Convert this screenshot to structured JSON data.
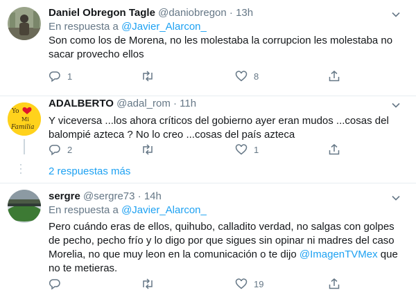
{
  "tweets": [
    {
      "name": "Daniel Obregon Tagle",
      "handle": "@daniobregon",
      "dot": "·",
      "time": "13h",
      "reply_prefix": "En respuesta a",
      "reply_to": "@Javier_Alarcon_",
      "body_lines": [
        "Son como los de Morena, no les molestaba la corrupcion les molestaba no",
        "sacar provecho ellos"
      ],
      "replies": "1",
      "retweets": "",
      "likes": "8"
    },
    {
      "name": "ADALBERTO",
      "handle": "@adal_rom",
      "dot": "·",
      "time": "11h",
      "body_lines": [
        "Y viceversa ...los ahora críticos del gobierno ayer eran mudos ...cosas del",
        "balompié azteca ? No lo creo ...cosas del país azteca"
      ],
      "replies": "2",
      "retweets": "",
      "likes": "1",
      "avatar_text": [
        "Yo",
        "Mi",
        "Familia"
      ]
    },
    {
      "name": "sergre",
      "handle": "@sergre73",
      "dot": "·",
      "time": "14h",
      "reply_prefix": "En respuesta a",
      "reply_to": "@Javier_Alarcon_",
      "body_lines": [
        "Pero cuándo eras de ellos, quihubo, calladito verdad, no salgas con golpes",
        "de pecho, pecho frío y lo digo por que sigues sin opinar ni madres del caso",
        "Morelia, no que muy leon en la comunicación o te dijo ",
        "no te metieras."
      ],
      "mention_inline": "@ImagenTVMex",
      "after_mention": " que",
      "replies": "",
      "retweets": "",
      "likes": "19"
    }
  ],
  "more_replies": "2 respuestas más",
  "colors": {
    "accent": "#1da1f2",
    "muted": "#657786",
    "divider": "#e6ecf0"
  }
}
